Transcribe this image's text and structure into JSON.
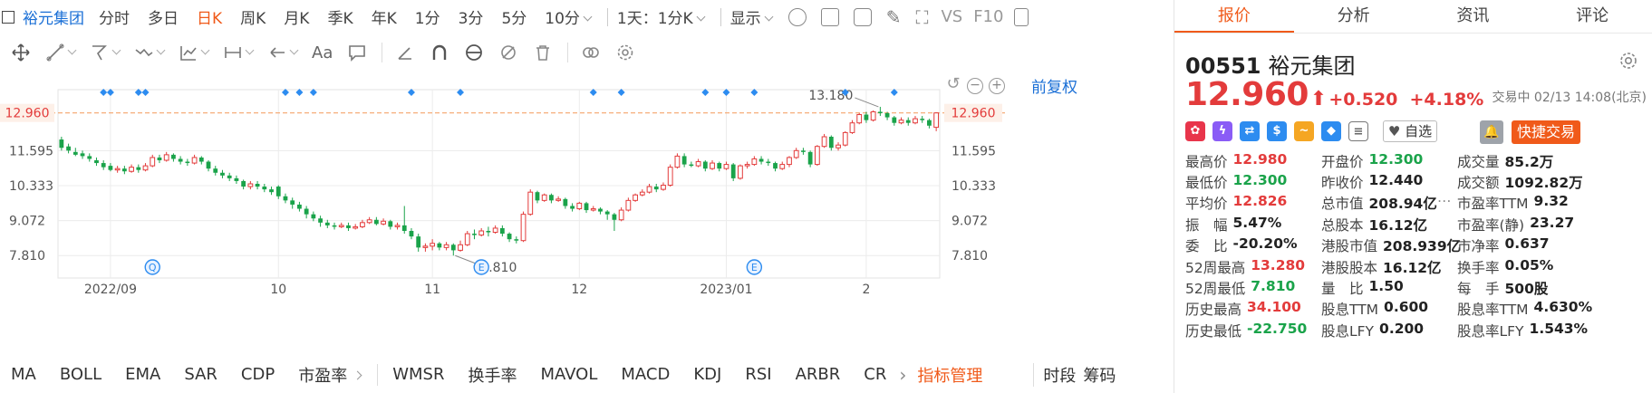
{
  "topbar": {
    "stock_name": "裕元集团",
    "periods": [
      "分时",
      "多日",
      "日K",
      "周K",
      "月K",
      "季K",
      "年K",
      "1分",
      "3分",
      "5分",
      "10分"
    ],
    "active_period": "日K",
    "interval_select": "1天：1分K",
    "display_select": "显示",
    "vs_label": "VS",
    "f10_label": "F10"
  },
  "toolbar": {
    "text_tool": "Aa"
  },
  "chart": {
    "adjust_label": "前复权",
    "current_price_label": "12.960",
    "annotation_high": "13.180",
    "annotation_low": "7.810",
    "event_badges": [
      "Q",
      "E",
      "E"
    ]
  },
  "chart_data": {
    "type": "candlestick",
    "y_ticks": [
      "12.960",
      "11.595",
      "10.333",
      "9.072",
      "7.810"
    ],
    "y_tick_values": [
      12.96,
      11.595,
      10.333,
      9.072,
      7.81
    ],
    "x_tick_labels": [
      "2022/09",
      "10",
      "11",
      "12",
      "2023/01",
      "2"
    ],
    "ylim": [
      7.0,
      13.8
    ],
    "reference_line": 12.96,
    "period_high": 13.18,
    "period_low": 7.81,
    "x_ticks": [
      {
        "label": "2022/09",
        "i": 7
      },
      {
        "label": "10",
        "i": 31
      },
      {
        "label": "11",
        "i": 53
      },
      {
        "label": "12",
        "i": 74
      },
      {
        "label": "2023/01",
        "i": 95
      },
      {
        "label": "2",
        "i": 115
      }
    ],
    "badges": [
      {
        "label": "Q",
        "i": 13
      },
      {
        "label": "E",
        "i": 60
      },
      {
        "label": "E",
        "i": 99
      }
    ],
    "markers": [
      6,
      7,
      11,
      12,
      32,
      34,
      36,
      50,
      57,
      76,
      80,
      92,
      95,
      99,
      112,
      119
    ],
    "candles": [
      [
        12.0,
        11.7,
        12.1,
        11.6
      ],
      [
        11.75,
        11.6,
        11.85,
        11.5
      ],
      [
        11.55,
        11.45,
        11.7,
        11.4
      ],
      [
        11.5,
        11.4,
        11.6,
        11.3
      ],
      [
        11.4,
        11.3,
        11.5,
        11.2
      ],
      [
        11.25,
        11.15,
        11.35,
        11.05
      ],
      [
        11.15,
        11.0,
        11.25,
        10.9
      ],
      [
        11.05,
        10.9,
        11.15,
        10.85
      ],
      [
        10.9,
        10.95,
        11.05,
        10.8
      ],
      [
        10.95,
        10.85,
        11.05,
        10.75
      ],
      [
        10.85,
        11.0,
        11.1,
        10.8
      ],
      [
        11.0,
        10.9,
        11.1,
        10.8
      ],
      [
        10.9,
        11.05,
        11.15,
        10.85
      ],
      [
        11.05,
        11.35,
        11.45,
        11.0
      ],
      [
        11.35,
        11.25,
        11.45,
        11.15
      ],
      [
        11.25,
        11.45,
        11.55,
        11.2
      ],
      [
        11.45,
        11.3,
        11.5,
        11.2
      ],
      [
        11.3,
        11.2,
        11.4,
        11.1
      ],
      [
        11.2,
        11.15,
        11.3,
        11.05
      ],
      [
        11.15,
        11.35,
        11.45,
        11.1
      ],
      [
        11.35,
        11.2,
        11.4,
        11.1
      ],
      [
        11.2,
        10.95,
        11.25,
        10.85
      ],
      [
        10.95,
        10.8,
        11.05,
        10.7
      ],
      [
        10.8,
        10.7,
        10.9,
        10.6
      ],
      [
        10.7,
        10.6,
        10.8,
        10.5
      ],
      [
        10.6,
        10.5,
        10.7,
        10.4
      ],
      [
        10.5,
        10.3,
        10.55,
        10.2
      ],
      [
        10.3,
        10.4,
        10.5,
        10.2
      ],
      [
        10.4,
        10.3,
        10.5,
        10.2
      ],
      [
        10.3,
        10.2,
        10.4,
        10.1
      ],
      [
        10.2,
        10.1,
        10.3,
        10.0
      ],
      [
        10.3,
        9.95,
        10.35,
        9.85
      ],
      [
        9.95,
        9.8,
        10.05,
        9.7
      ],
      [
        9.8,
        9.65,
        9.9,
        9.5
      ],
      [
        9.65,
        9.5,
        9.75,
        9.4
      ],
      [
        9.5,
        9.3,
        9.6,
        9.15
      ],
      [
        9.3,
        9.15,
        9.4,
        9.05
      ],
      [
        9.15,
        9.0,
        9.25,
        8.85
      ],
      [
        9.0,
        8.9,
        9.1,
        8.8
      ],
      [
        8.9,
        8.85,
        9.0,
        8.75
      ],
      [
        8.85,
        8.9,
        9.0,
        8.8
      ],
      [
        8.9,
        8.8,
        9.0,
        8.7
      ],
      [
        8.8,
        8.85,
        8.95,
        8.75
      ],
      [
        8.85,
        9.0,
        9.1,
        8.8
      ],
      [
        9.0,
        9.1,
        9.2,
        8.95
      ],
      [
        9.1,
        8.95,
        9.2,
        8.9
      ],
      [
        8.95,
        9.05,
        9.15,
        8.9
      ],
      [
        9.05,
        8.85,
        9.1,
        8.75
      ],
      [
        8.85,
        8.9,
        9.0,
        8.75
      ],
      [
        8.9,
        8.7,
        9.6,
        8.6
      ],
      [
        8.7,
        8.5,
        8.8,
        8.4
      ],
      [
        8.5,
        8.1,
        8.6,
        7.95
      ],
      [
        8.1,
        8.15,
        8.25,
        7.95
      ],
      [
        8.15,
        8.25,
        8.4,
        8.0
      ],
      [
        8.25,
        8.1,
        8.3,
        8.0
      ],
      [
        8.1,
        8.2,
        8.3,
        8.0
      ],
      [
        8.2,
        8.0,
        8.25,
        7.81
      ],
      [
        8.0,
        8.2,
        8.35,
        7.95
      ],
      [
        8.2,
        8.6,
        8.7,
        8.15
      ],
      [
        8.6,
        8.55,
        8.75,
        8.4
      ],
      [
        8.55,
        8.7,
        8.8,
        8.5
      ],
      [
        8.7,
        8.65,
        8.85,
        8.5
      ],
      [
        8.65,
        8.8,
        8.9,
        8.6
      ],
      [
        8.8,
        8.6,
        8.9,
        8.5
      ],
      [
        8.6,
        8.4,
        8.65,
        8.3
      ],
      [
        8.4,
        8.35,
        8.5,
        8.25
      ],
      [
        8.35,
        9.3,
        9.4,
        8.3
      ],
      [
        9.3,
        10.1,
        10.2,
        9.25
      ],
      [
        10.1,
        9.8,
        10.15,
        9.7
      ],
      [
        9.8,
        10.0,
        10.05,
        9.75
      ],
      [
        10.0,
        9.8,
        10.05,
        9.7
      ],
      [
        9.8,
        9.85,
        9.95,
        9.75
      ],
      [
        9.85,
        9.6,
        9.9,
        9.5
      ],
      [
        9.6,
        9.5,
        9.7,
        9.4
      ],
      [
        9.5,
        9.7,
        9.75,
        9.45
      ],
      [
        9.7,
        9.45,
        9.75,
        9.35
      ],
      [
        9.45,
        9.5,
        9.6,
        9.4
      ],
      [
        9.5,
        9.4,
        9.55,
        9.3
      ],
      [
        9.4,
        9.3,
        9.45,
        9.1
      ],
      [
        9.3,
        9.1,
        9.35,
        8.7
      ],
      [
        9.1,
        9.45,
        9.55,
        9.05
      ],
      [
        9.45,
        9.8,
        9.9,
        9.4
      ],
      [
        9.8,
        10.0,
        10.05,
        9.75
      ],
      [
        10.0,
        10.1,
        10.2,
        9.95
      ],
      [
        10.1,
        10.3,
        10.4,
        10.05
      ],
      [
        10.3,
        10.2,
        10.4,
        10.1
      ],
      [
        10.2,
        10.35,
        10.45,
        10.15
      ],
      [
        10.35,
        11.0,
        11.1,
        10.3
      ],
      [
        11.0,
        11.4,
        11.5,
        10.95
      ],
      [
        11.4,
        11.1,
        11.5,
        11.0
      ],
      [
        11.1,
        11.05,
        11.2,
        11.0
      ],
      [
        11.05,
        11.2,
        11.3,
        11.0
      ],
      [
        11.2,
        10.95,
        11.25,
        10.85
      ],
      [
        10.95,
        11.15,
        11.25,
        10.9
      ],
      [
        11.15,
        10.95,
        11.2,
        10.85
      ],
      [
        10.95,
        11.1,
        11.2,
        10.9
      ],
      [
        11.1,
        10.6,
        11.15,
        10.5
      ],
      [
        10.6,
        11.05,
        11.1,
        10.55
      ],
      [
        11.05,
        11.1,
        11.2,
        10.95
      ],
      [
        11.1,
        11.3,
        11.4,
        11.05
      ],
      [
        11.3,
        11.2,
        11.4,
        11.1
      ],
      [
        11.2,
        11.15,
        11.3,
        11.05
      ],
      [
        11.15,
        10.95,
        11.2,
        10.85
      ],
      [
        10.95,
        11.1,
        11.2,
        10.9
      ],
      [
        11.1,
        11.35,
        11.4,
        11.0
      ],
      [
        11.35,
        11.6,
        11.7,
        11.3
      ],
      [
        11.6,
        11.55,
        11.7,
        11.45
      ],
      [
        11.55,
        11.1,
        11.6,
        11.0
      ],
      [
        11.1,
        11.75,
        11.8,
        11.05
      ],
      [
        11.75,
        12.1,
        12.2,
        11.7
      ],
      [
        12.1,
        11.7,
        12.15,
        11.6
      ],
      [
        11.7,
        11.8,
        11.9,
        11.6
      ],
      [
        11.8,
        12.25,
        12.3,
        11.75
      ],
      [
        12.25,
        12.6,
        12.7,
        12.2
      ],
      [
        12.6,
        12.9,
        12.95,
        12.55
      ],
      [
        12.9,
        12.7,
        13.0,
        12.6
      ],
      [
        12.7,
        13.0,
        13.05,
        12.65
      ],
      [
        13.0,
        12.95,
        13.18,
        12.85
      ],
      [
        12.95,
        12.8,
        13.0,
        12.7
      ],
      [
        12.8,
        12.6,
        12.85,
        12.5
      ],
      [
        12.6,
        12.7,
        12.8,
        12.55
      ],
      [
        12.7,
        12.6,
        12.8,
        12.5
      ],
      [
        12.6,
        12.75,
        12.85,
        12.55
      ],
      [
        12.75,
        12.7,
        12.85,
        12.6
      ],
      [
        12.7,
        12.5,
        12.75,
        12.4
      ],
      [
        12.44,
        12.96,
        12.98,
        12.3
      ]
    ]
  },
  "indicators": {
    "items": [
      "MA",
      "BOLL",
      "EMA",
      "SAR",
      "CDP",
      "市盈率",
      "WMSR",
      "换手率",
      "MAVOL",
      "MACD",
      "KDJ",
      "RSI",
      "ARBR",
      "CR"
    ],
    "manager": "指标管理",
    "right": [
      "时段",
      "筹码"
    ]
  },
  "panel": {
    "tabs": [
      "报价",
      "分析",
      "资讯",
      "评论"
    ],
    "active_tab": "报价",
    "code": "00551",
    "name": "裕元集团",
    "price": "12.960",
    "change": "+0.520",
    "change_pct": "+4.18%",
    "status": "交易中 02/13 14:08(北京)",
    "watchlist_label": "自选",
    "quick_trade_label": "快捷交易",
    "colors": {
      "up": "#e33b3b",
      "down": "#1aa34a",
      "accent": "#f05a1a",
      "link": "#1a6fd6"
    },
    "stats": [
      [
        {
          "label": "最高价",
          "value": "12.980",
          "tone": "up"
        },
        {
          "label": "开盘价",
          "value": "12.300",
          "tone": "down"
        },
        {
          "label": "成交量",
          "value": "85.2万",
          "tone": ""
        }
      ],
      [
        {
          "label": "最低价",
          "value": "12.300",
          "tone": "down"
        },
        {
          "label": "昨收价",
          "value": "12.440",
          "tone": ""
        },
        {
          "label": "成交额",
          "value": "1092.82万",
          "tone": ""
        }
      ],
      [
        {
          "label": "平均价",
          "value": "12.826",
          "tone": "up"
        },
        {
          "label": "总市值",
          "value": "208.94亿",
          "tone": ""
        },
        {
          "label": "市盈率TTM",
          "value": "9.32",
          "tone": ""
        }
      ],
      [
        {
          "label": "振　幅",
          "value": "5.47%",
          "tone": ""
        },
        {
          "label": "总股本",
          "value": "16.12亿",
          "tone": ""
        },
        {
          "label": "市盈率(静)",
          "value": "23.27",
          "tone": ""
        }
      ],
      [
        {
          "label": "委　比",
          "value": "-20.20%",
          "tone": ""
        },
        {
          "label": "港股市值",
          "value": "208.939亿",
          "tone": ""
        },
        {
          "label": "市净率",
          "value": "0.637",
          "tone": ""
        }
      ],
      [
        {
          "label": "52周最高",
          "value": "13.280",
          "tone": "up"
        },
        {
          "label": "港股股本",
          "value": "16.12亿",
          "tone": ""
        },
        {
          "label": "换手率",
          "value": "0.05%",
          "tone": ""
        }
      ],
      [
        {
          "label": "52周最低",
          "value": "7.810",
          "tone": "down"
        },
        {
          "label": "量　比",
          "value": "1.50",
          "tone": ""
        },
        {
          "label": "每　手",
          "value": "500股",
          "tone": ""
        }
      ],
      [
        {
          "label": "历史最高",
          "value": "34.100",
          "tone": "up"
        },
        {
          "label": "股息TTM",
          "value": "0.600",
          "tone": ""
        },
        {
          "label": "股息率TTM",
          "value": "4.630%",
          "tone": ""
        }
      ],
      [
        {
          "label": "历史最低",
          "value": "-22.750",
          "tone": "down"
        },
        {
          "label": "股息LFY",
          "value": "0.200",
          "tone": ""
        },
        {
          "label": "股息率LFY",
          "value": "1.543%",
          "tone": ""
        }
      ]
    ]
  }
}
